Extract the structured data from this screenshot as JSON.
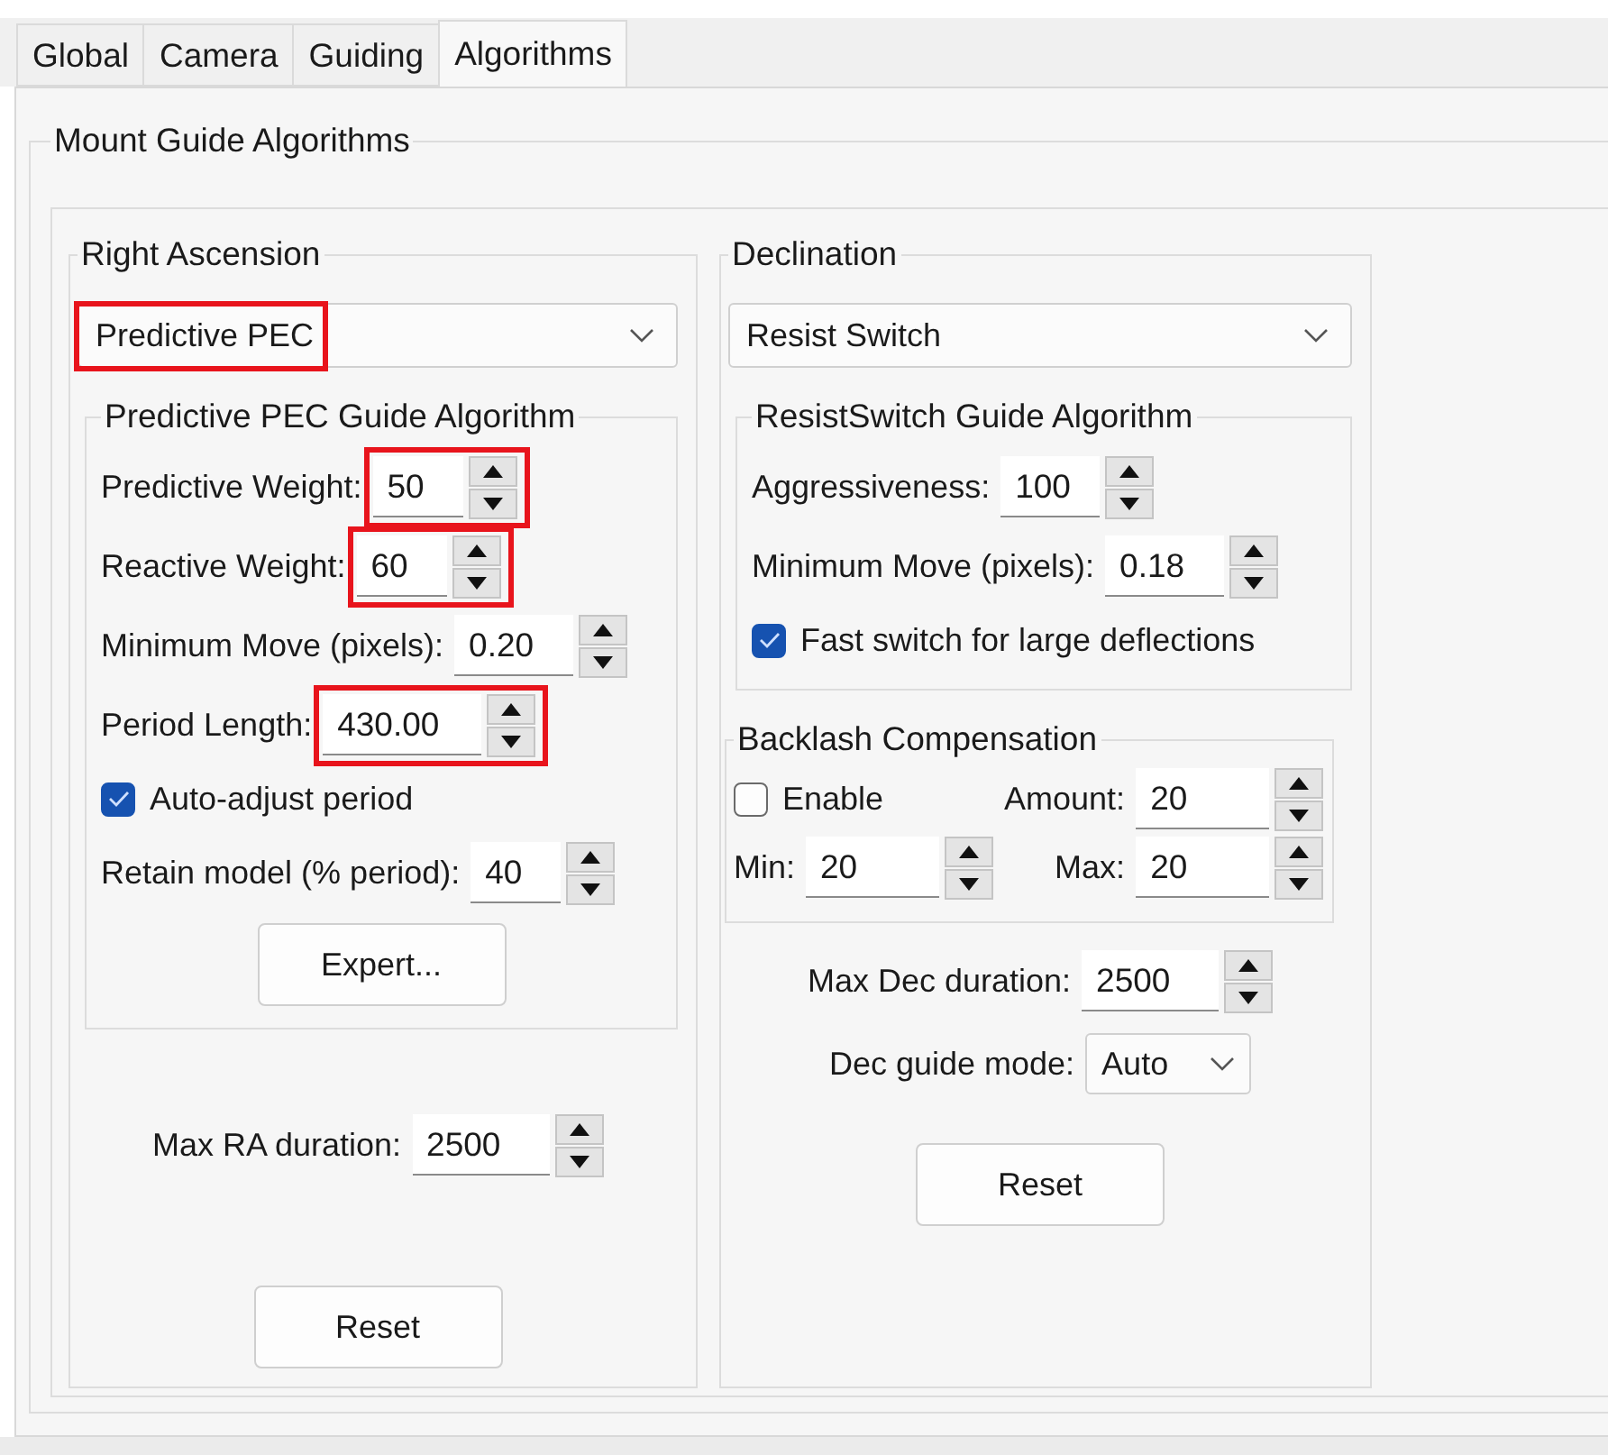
{
  "tabs": [
    {
      "label": "Global",
      "selected": false
    },
    {
      "label": "Camera",
      "selected": false
    },
    {
      "label": "Guiding",
      "selected": false
    },
    {
      "label": "Algorithms",
      "selected": true
    }
  ],
  "panel": {
    "title": "Mount Guide Algorithms",
    "right_ascension": {
      "title": "Right Ascension",
      "algorithm": {
        "value": "Predictive PEC",
        "highlighted": true
      },
      "algorithm_group": {
        "title": "Predictive PEC Guide Algorithm",
        "fields": [
          {
            "kind": "spin",
            "label": "Predictive Weight:",
            "value": "50",
            "highlighted": true
          },
          {
            "kind": "spin",
            "label": "Reactive Weight:",
            "value": "60",
            "highlighted": true
          },
          {
            "kind": "spin",
            "label": "Minimum Move (pixels):",
            "value": "0.20",
            "highlighted": false
          },
          {
            "kind": "spin",
            "label": "Period Length:",
            "value": "430.00",
            "highlighted": true
          },
          {
            "kind": "checkbox",
            "label": "Auto-adjust period",
            "checked": true
          },
          {
            "kind": "spin",
            "label": "Retain model (% period):",
            "value": "40",
            "highlighted": false
          }
        ],
        "button": "Expert..."
      },
      "max_duration": {
        "label": "Max RA duration:",
        "value": "2500"
      },
      "reset": "Reset"
    },
    "declination": {
      "title": "Declination",
      "algorithm": {
        "value": "Resist Switch",
        "highlighted": false
      },
      "algorithm_group": {
        "title": "ResistSwitch Guide Algorithm",
        "fields": [
          {
            "kind": "spin",
            "label": "Aggressiveness:",
            "value": "100",
            "highlighted": false
          },
          {
            "kind": "spin",
            "label": "Minimum Move (pixels):",
            "value": "0.18",
            "highlighted": false
          },
          {
            "kind": "checkbox",
            "label": "Fast switch for large deflections",
            "checked": true
          }
        ]
      },
      "backlash": {
        "title": "Backlash Compensation",
        "enable": {
          "label": "Enable",
          "checked": false
        },
        "amount": {
          "label": "Amount:",
          "value": "20"
        },
        "min": {
          "label": "Min:",
          "value": "20"
        },
        "max": {
          "label": "Max:",
          "value": "20"
        }
      },
      "max_duration": {
        "label": "Max Dec duration:",
        "value": "2500"
      },
      "guide_mode": {
        "label": "Dec guide mode:",
        "value": "Auto"
      },
      "reset": "Reset"
    }
  }
}
